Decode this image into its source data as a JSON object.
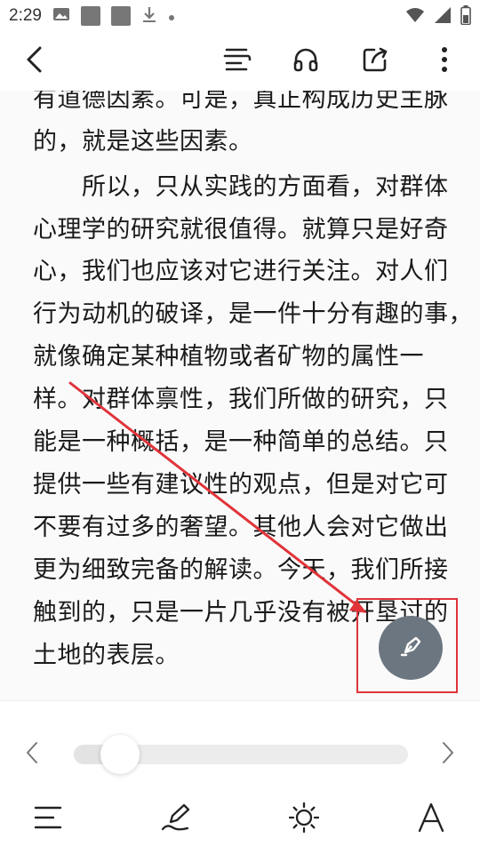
{
  "status_bar": {
    "time": "2:29",
    "icons": [
      "gallery-icon",
      "gray-square-icon",
      "gray-square-icon",
      "download-icon",
      "dot-icon",
      "wifi-icon",
      "signal-icon",
      "battery-icon"
    ]
  },
  "toolbar": {
    "back": "back-arrow-icon",
    "actions": [
      "toc-list-icon",
      "headphones-icon",
      "share-icon",
      "more-vertical-icon"
    ]
  },
  "reader": {
    "lines": [
      "有道德因素。可是，真正构成历史主脉",
      "的，就是这些因素。",
      "　　所以，只从实践的方面看，对群体",
      "心理学的研究就很值得。就算只是好奇",
      "心，我们也应该对它进行关注。对人们",
      "行为动机的破译，是一件十分有趣的事，",
      "就像确定某种植物或者矿物的属性一",
      "样。对群体禀性，我们所做的研究，只",
      "能是一种概括，是一种简单的总结。只",
      "提供一些有建议性的观点，但是对它可",
      "不要有过多的奢望。其他人会对它做出",
      "更为细致完备的解读。今天，我们所接",
      "触到的，只是一片几乎没有被开垦过的",
      "土地的表层。"
    ]
  },
  "annotation": {
    "arrow_color": "#e0343a",
    "box_color": "#e0343a"
  },
  "fab": {
    "icon": "pen-nib-icon",
    "color": "#6c7680"
  },
  "progress": {
    "value_fraction": 0.07
  },
  "bottom_tools": [
    "menu-list-icon",
    "pen-write-icon",
    "brightness-icon",
    "font-size-icon"
  ]
}
